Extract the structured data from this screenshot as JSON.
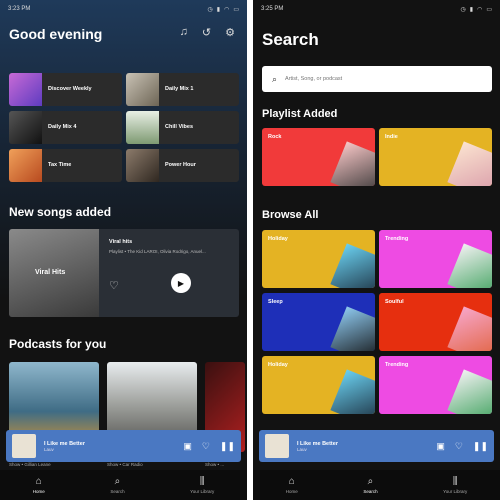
{
  "home": {
    "status": {
      "time": "3:23 PM"
    },
    "greeting": "Good evening",
    "quick": [
      "Discover Weekly",
      "Daily Mix 1",
      "Daily Mix 4",
      "Chill Vibes",
      "Tax Time",
      "Power Hour"
    ],
    "new_songs_title": "New songs added",
    "new_card": {
      "tag": "Viral Hits",
      "title": "Viral hits",
      "subtitle": "Playlist • The Kid LAROI, Olivia Rodrigo, Anuel..."
    },
    "podcasts_title": "Podcasts for you",
    "pod_captions": [
      "Show • Gillian Leane",
      "Show • Car Radio",
      "Show • ..."
    ],
    "player": {
      "title": "I Like me Better",
      "artist": "Lauv"
    },
    "nav": [
      "Home",
      "Search",
      "Your Library"
    ]
  },
  "search": {
    "status": {
      "time": "3:25 PM"
    },
    "title": "Search",
    "placeholder": "Artist, Song, or podcast",
    "playlist_added_title": "Playlist Added",
    "playlist_tiles": [
      "Rock",
      "Indie"
    ],
    "browse_title": "Browse All",
    "browse_tiles": [
      "Holiday",
      "Trending",
      "Sleep",
      "Soulful",
      "Holiday",
      "Trending"
    ],
    "player": {
      "title": "I Like me Better",
      "artist": "Lauv"
    },
    "nav": [
      "Home",
      "Search",
      "Your Library"
    ]
  },
  "colors": {
    "accent_blue": "#4a78c2",
    "rock": "#f13a3a",
    "indie": "#e4b323",
    "pink": "#ee4be3",
    "sleep": "#1e2fb8",
    "soulful": "#e62f0f"
  }
}
